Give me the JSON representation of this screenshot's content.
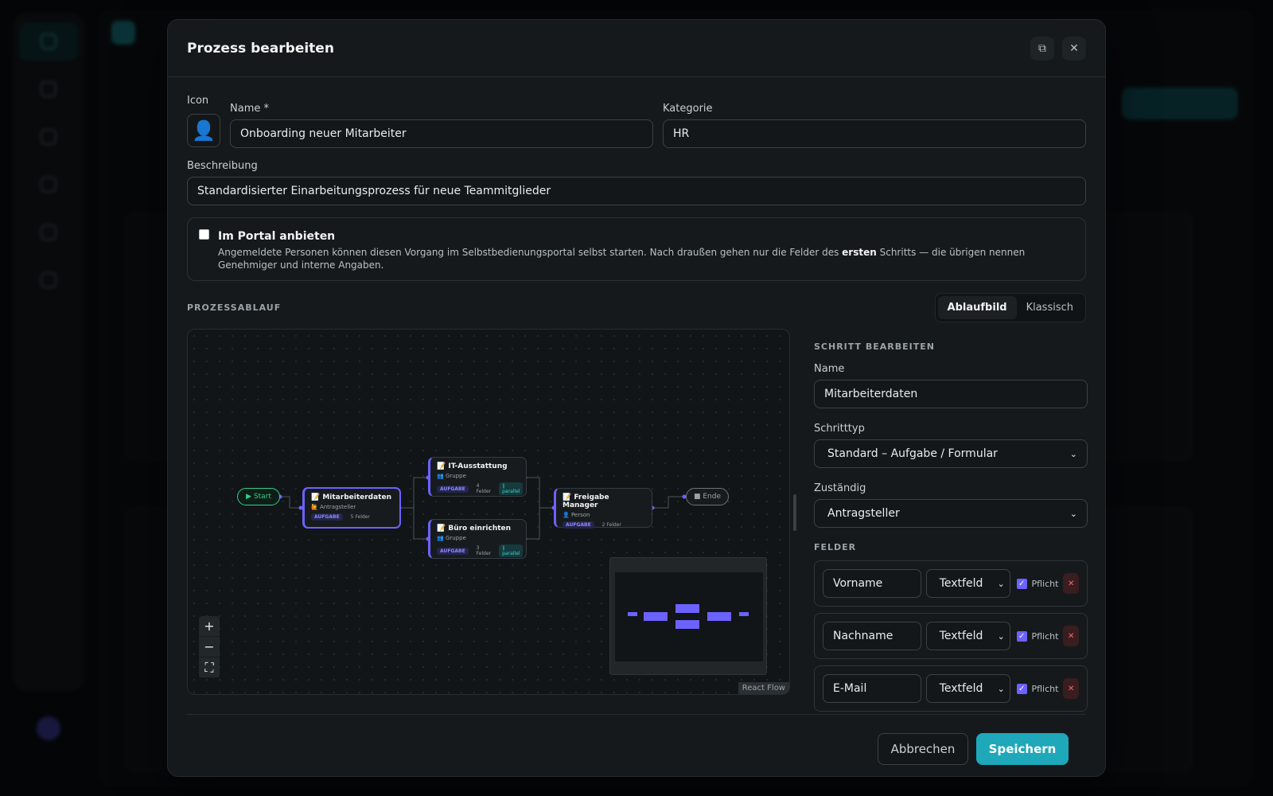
{
  "modal": {
    "title": "Prozess bearbeiten",
    "icon_label": "Icon",
    "icon_value": "👤",
    "name_label": "Name *",
    "name_value": "Onboarding neuer Mitarbeiter",
    "category_label": "Kategorie",
    "category_value": "HR",
    "description_label": "Beschreibung",
    "description_value": "Standardisierter Einarbeitungsprozess für neue Teammitglieder",
    "portal": {
      "title": "Im Portal anbieten",
      "checked": false,
      "text_before": "Angemeldete Personen können diesen Vorgang im Selbstbedienungsportal selbst starten. Nach draußen gehen nur die Felder des ",
      "text_bold": "ersten",
      "text_after": " Schritts — die übrigen nennen Genehmiger und interne Angaben."
    },
    "flow_section_title": "PROZESSABLAUF",
    "view_tabs": [
      "Ablaufbild",
      "Klassisch"
    ],
    "active_view": "Ablaufbild",
    "cancel_label": "Abbrechen",
    "save_label": "Speichern"
  },
  "flow": {
    "start_label": "▶ Start",
    "end_label": "■ Ende",
    "attribution": "React Flow",
    "nodes": [
      {
        "title": "📝 Mitarbeiterdaten",
        "sub": "🙋 Antragsteller",
        "tag": "AUFGABE",
        "fields": "5 Felder",
        "parallel": ""
      },
      {
        "title": "📝 IT-Ausstattung",
        "sub": "👥 Gruppe",
        "tag": "AUFGABE",
        "fields": "4 Felder",
        "parallel": "∥ parallel"
      },
      {
        "title": "📝 Büro einrichten",
        "sub": "👥 Gruppe",
        "tag": "AUFGABE",
        "fields": "3 Felder",
        "parallel": "∥ parallel"
      },
      {
        "title": "📝 Freigabe Manager",
        "sub": "👤 Person",
        "tag": "AUFGABE",
        "fields": "2 Felder",
        "parallel": ""
      }
    ],
    "zoom_controls": [
      "+",
      "−",
      "⛶"
    ]
  },
  "step_editor": {
    "title": "SCHRITT BEARBEITEN",
    "name_label": "Name",
    "name_value": "Mitarbeiterdaten",
    "type_label": "Schritttyp",
    "type_value": "Standard – Aufgabe / Formular",
    "owner_label": "Zuständig",
    "owner_value": "Antragsteller",
    "fields_title": "FELDER",
    "fields": [
      {
        "name": "Vorname",
        "type": "Textfeld",
        "required_label": "Pflicht",
        "required": true
      },
      {
        "name": "Nachname",
        "type": "Textfeld",
        "required_label": "Pflicht",
        "required": true
      },
      {
        "name": "E-Mail",
        "type": "Textfeld",
        "required_label": "Pflicht",
        "required": true
      }
    ]
  },
  "colors": {
    "accent": "#1fa7ba",
    "node_accent": "#6c63ff",
    "start_green": "#2fcf8e"
  }
}
